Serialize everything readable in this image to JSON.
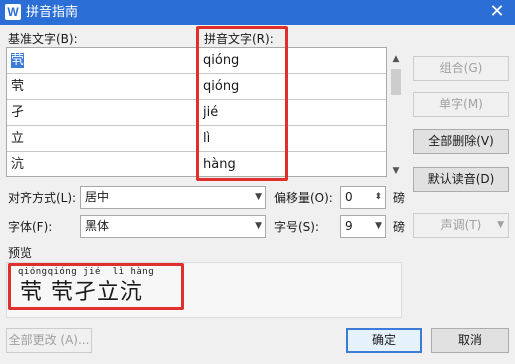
{
  "window": {
    "icon_text": "W",
    "title": "拼音指南",
    "close_glyph": "✕"
  },
  "columns": {
    "base": "基准文字(B):",
    "pinyin": "拼音文字(R):"
  },
  "rows": [
    {
      "char": "茕",
      "pinyin": "qióng"
    },
    {
      "char": "茕",
      "pinyin": "qióng"
    },
    {
      "char": "孑",
      "pinyin": "jié"
    },
    {
      "char": "立",
      "pinyin": "lì"
    },
    {
      "char": "沆",
      "pinyin": "hàng"
    }
  ],
  "buttons": {
    "combine": "组合(G)",
    "single": "单字(M)",
    "delete_all": "全部删除(V)",
    "default_reading": "默认读音(D)",
    "tone": "声调(T)",
    "change_all": "全部更改 (A)...",
    "ok": "确定",
    "cancel": "取消"
  },
  "options": {
    "alignment_label": "对齐方式(L):",
    "alignment_value": "居中",
    "offset_label": "偏移量(O):",
    "offset_value": "0",
    "offset_unit": "磅",
    "font_label": "字体(F):",
    "font_value": "黑体",
    "size_label": "字号(S):",
    "size_value": "9",
    "size_unit": "磅"
  },
  "preview": {
    "label": "预览",
    "pinyin_line": "qióngqióng jié  lì hàng",
    "chars_line": "茕 茕孑立沆"
  },
  "colors": {
    "titlebar": "#2b6fd6",
    "highlight": "#e0302b",
    "selection": "#3d7bd9"
  }
}
